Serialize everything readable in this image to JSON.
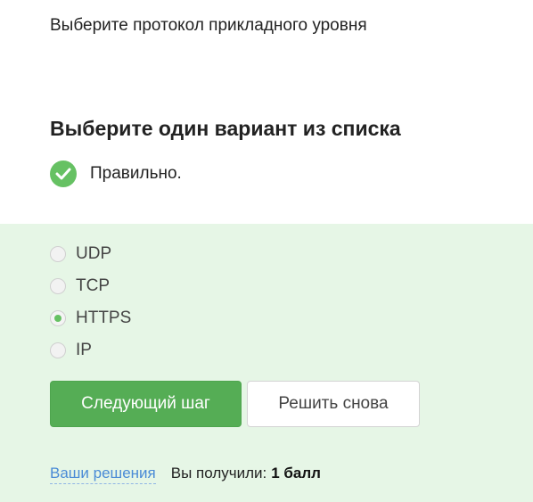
{
  "question": {
    "text": "Выберите протокол прикладного уровня"
  },
  "prompt": {
    "text": "Выберите один вариант из списка"
  },
  "feedback": {
    "icon": "check-circle-icon",
    "text": "Правильно.",
    "color": "#66c163"
  },
  "options": [
    {
      "label": "UDP",
      "selected": false
    },
    {
      "label": "TCP",
      "selected": false
    },
    {
      "label": "HTTPS",
      "selected": true
    },
    {
      "label": "IP",
      "selected": false
    }
  ],
  "buttons": {
    "next_label": "Следующий шаг",
    "retry_label": "Решить снова"
  },
  "footer": {
    "solutions_link": "Ваши решения",
    "score_label": "Вы получили:",
    "score_value": "1 балл"
  },
  "colors": {
    "panel_bg": "#e6f6e6",
    "primary": "#55ad55",
    "link": "#4a8bd6"
  }
}
